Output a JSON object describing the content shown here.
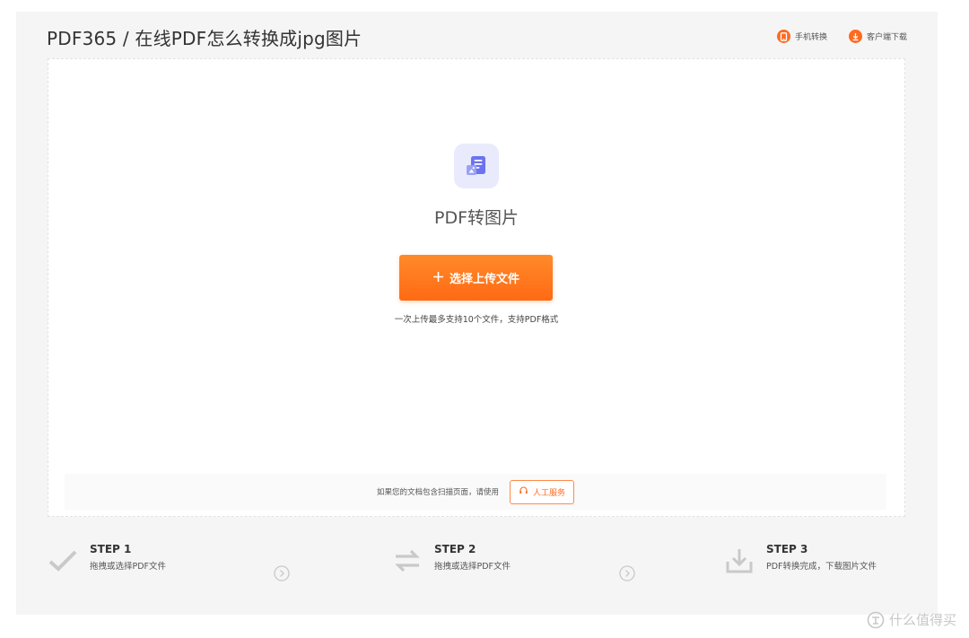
{
  "header": {
    "title": "PDF365 / 在线PDF怎么转换成jpg图片",
    "links": [
      {
        "label": "手机转换",
        "icon": "mobile-icon"
      },
      {
        "label": "客户端下载",
        "icon": "download-icon"
      }
    ]
  },
  "upload": {
    "tool_icon": "pdf-to-image-icon",
    "tool_name": "PDF转图片",
    "button_label": "选择上传文件",
    "button_icon": "plus-icon",
    "hint": "一次上传最多支持10个文件，支持PDF格式"
  },
  "service": {
    "text": "如果您的文档包含扫描页面，请使用",
    "button_label": "人工服务",
    "button_icon": "headset-icon"
  },
  "steps": [
    {
      "title": "STEP 1",
      "desc": "拖拽或选择PDF文件",
      "icon": "check-icon"
    },
    {
      "title": "STEP 2",
      "desc": "拖拽或选择PDF文件",
      "icon": "convert-arrows-icon"
    },
    {
      "title": "STEP 3",
      "desc": "PDF转换完成，下载图片文件",
      "icon": "download-tray-icon"
    }
  ],
  "watermark": {
    "text": "什么值得买",
    "icon": "smzdm-logo-icon"
  },
  "colors": {
    "accent": "#ff6a1f",
    "panel_background": "#f5f5f5",
    "tool_icon_bg": "#e9ebfc",
    "tool_icon_fg": "#6b73f0"
  }
}
